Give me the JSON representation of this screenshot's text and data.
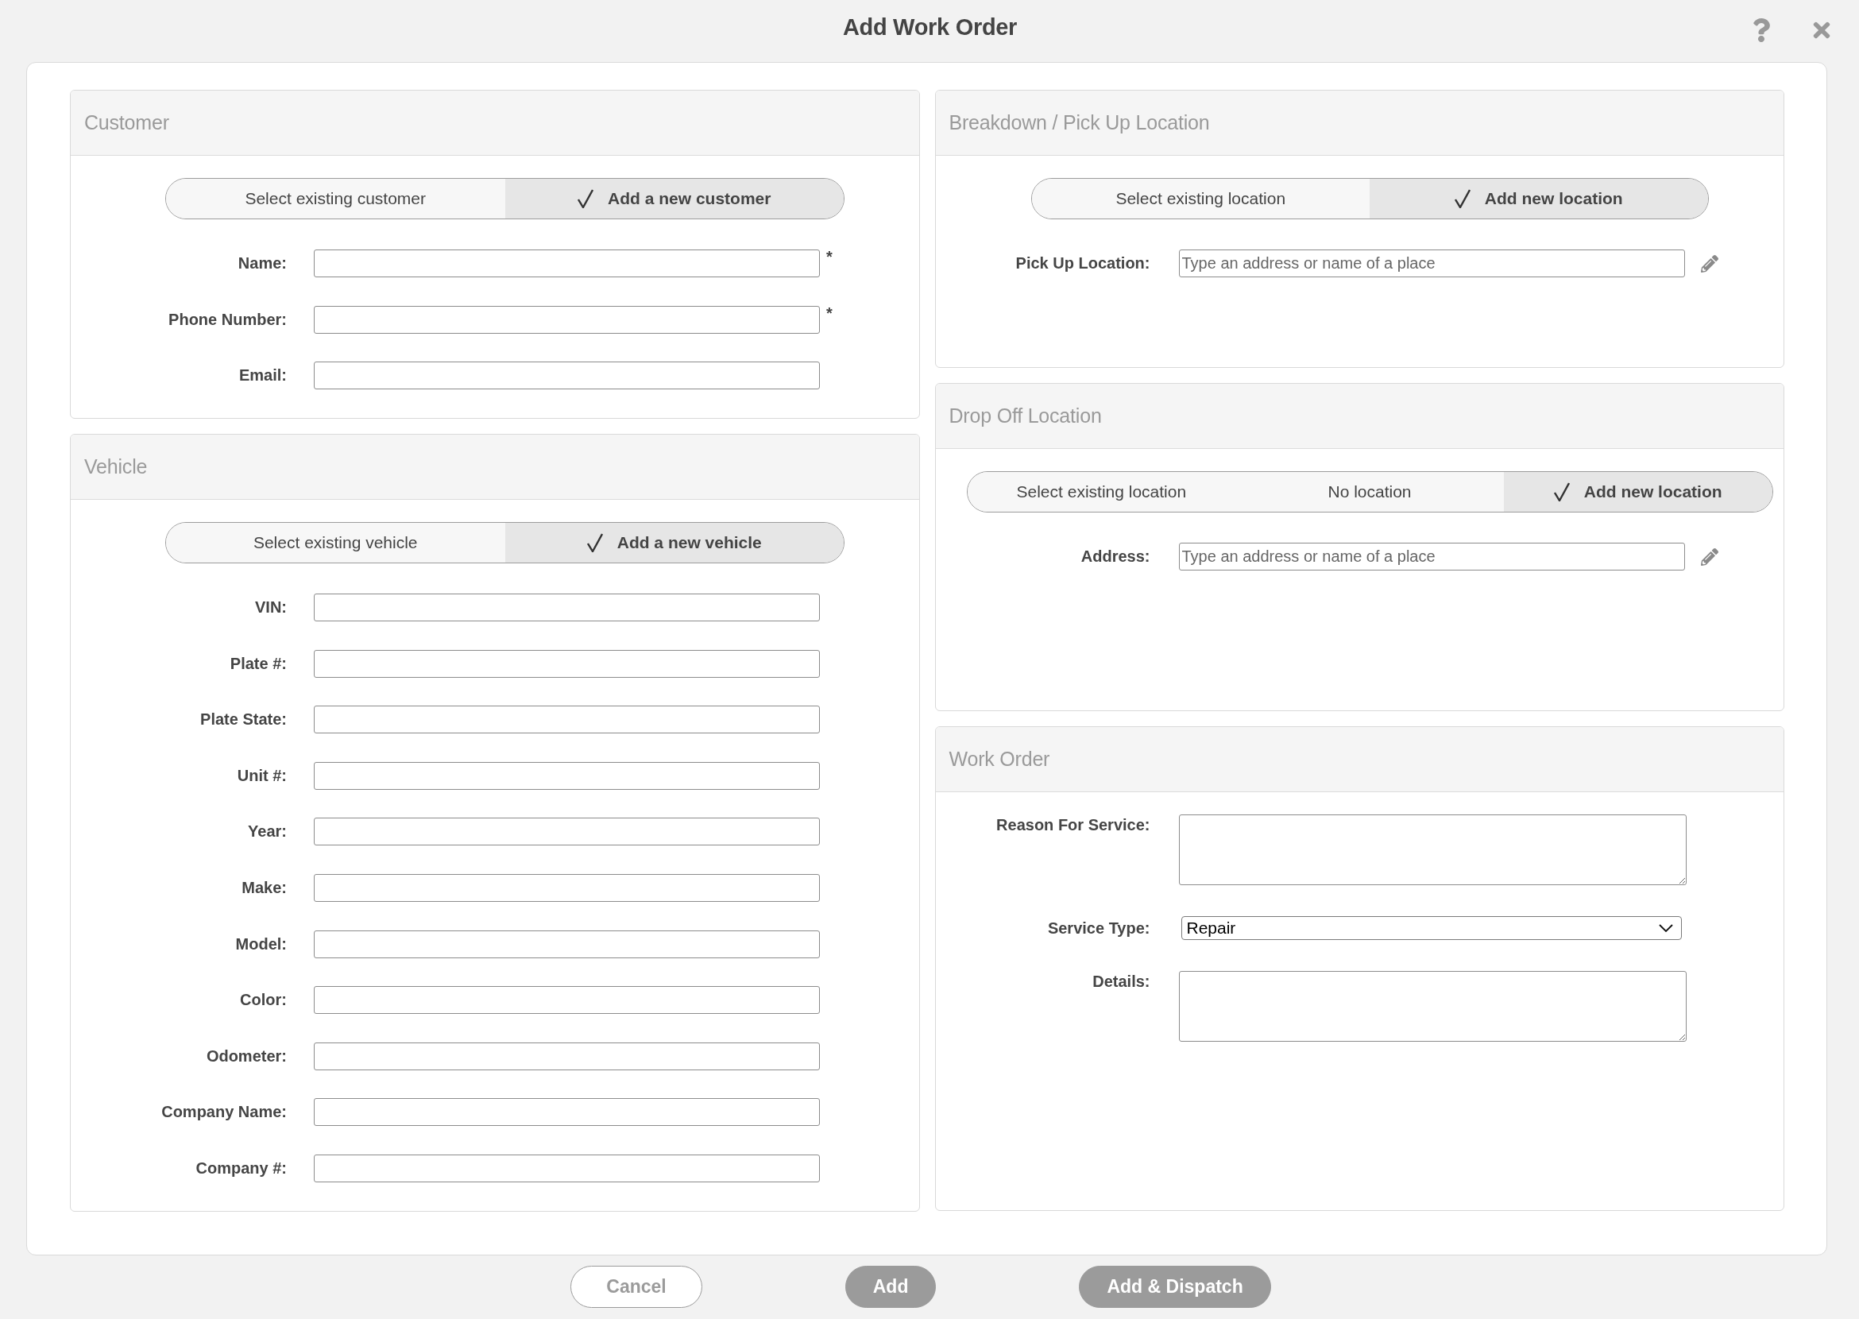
{
  "window": {
    "title": "Add Work Order"
  },
  "customer": {
    "title": "Customer",
    "mode_toggle": [
      {
        "label": "Select existing customer",
        "selected": false
      },
      {
        "label": "Add a new customer",
        "selected": true
      }
    ],
    "fields": [
      {
        "kind": "text",
        "label": "Name:",
        "required_mark": "*"
      },
      {
        "kind": "text",
        "label": "Phone Number:",
        "required_mark": "*"
      },
      {
        "kind": "text",
        "label": "Email:"
      }
    ]
  },
  "vehicle": {
    "title": "Vehicle",
    "mode_toggle": [
      {
        "label": "Select existing vehicle",
        "selected": false
      },
      {
        "label": "Add a new vehicle",
        "selected": true
      }
    ],
    "fields": [
      {
        "kind": "text",
        "label": "VIN:"
      },
      {
        "kind": "text",
        "label": "Plate #:"
      },
      {
        "kind": "text",
        "label": "Plate State:"
      },
      {
        "kind": "text",
        "label": "Unit #:"
      },
      {
        "kind": "text",
        "label": "Year:"
      },
      {
        "kind": "text",
        "label": "Make:"
      },
      {
        "kind": "text",
        "label": "Model:"
      },
      {
        "kind": "text",
        "label": "Color:"
      },
      {
        "kind": "text",
        "label": "Odometer:"
      },
      {
        "kind": "text",
        "label": "Company Name:"
      },
      {
        "kind": "text",
        "label": "Company #:"
      }
    ]
  },
  "pickup_location": {
    "title": "Breakdown / Pick Up Location",
    "mode_toggle": [
      {
        "label": "Select existing location",
        "selected": false
      },
      {
        "label": "Add new location",
        "selected": true
      }
    ],
    "fields": [
      {
        "kind": "address",
        "label": "Pick Up Location:",
        "placeholder": "Type an address or name of a place"
      }
    ]
  },
  "dropoff_location": {
    "title": "Drop Off Location",
    "mode_toggle": [
      {
        "label": "Select existing location",
        "selected": false
      },
      {
        "label": "No location",
        "selected": false
      },
      {
        "label": "Add new location",
        "selected": true
      }
    ],
    "fields": [
      {
        "kind": "address",
        "label": "Address:",
        "placeholder": "Type an address or name of a place"
      }
    ]
  },
  "work_order": {
    "title": "Work Order",
    "fields": [
      {
        "kind": "textarea",
        "label": "Reason For Service:"
      },
      {
        "kind": "select",
        "label": "Service Type:",
        "value": "Repair"
      },
      {
        "kind": "textarea",
        "label": "Details:"
      }
    ]
  },
  "buttons": [
    {
      "label": "Cancel",
      "kind": "secondary"
    },
    {
      "label": "Add",
      "kind": "primary"
    },
    {
      "label": "Add & Dispatch",
      "kind": "primary"
    }
  ]
}
